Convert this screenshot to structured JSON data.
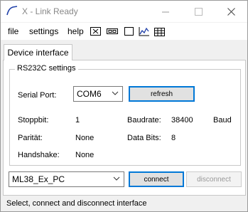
{
  "window": {
    "title": "X - Link Ready",
    "controls": [
      "minimize-icon",
      "maximize-icon",
      "close-icon"
    ]
  },
  "menu": {
    "file": "file",
    "settings": "settings",
    "help": "help",
    "toolbar_icons": [
      "close-window-icon",
      "connection-icon",
      "blank-window-icon",
      "chart-icon",
      "table-icon"
    ]
  },
  "tab": {
    "label": "Device interface"
  },
  "rs232": {
    "group_label": "RS232C settings",
    "serial_port_label": "Serial Port:",
    "serial_port_value": "COM6",
    "refresh_label": "refresh",
    "stoppbit_label": "Stoppbit:",
    "stoppbit_value": "1",
    "baudrate_label": "Baudrate:",
    "baudrate_value": "38400",
    "baudrate_unit": "Baud",
    "paritat_label": "Parität:",
    "paritat_value": "None",
    "databits_label": "Data Bits:",
    "databits_value": "8",
    "handshake_label": "Handshake:",
    "handshake_value": "None"
  },
  "device": {
    "selected": "ML38_Ex_PC",
    "connect_label": "connect",
    "disconnect_label": "disconnect"
  },
  "status": {
    "text": "Select, connect and disconnect interface"
  },
  "colors": {
    "accent": "#0078d7",
    "app_icon": "#1f3fa8",
    "tab_bg": "#ffffff",
    "window_bg": "#f0f0f0"
  }
}
